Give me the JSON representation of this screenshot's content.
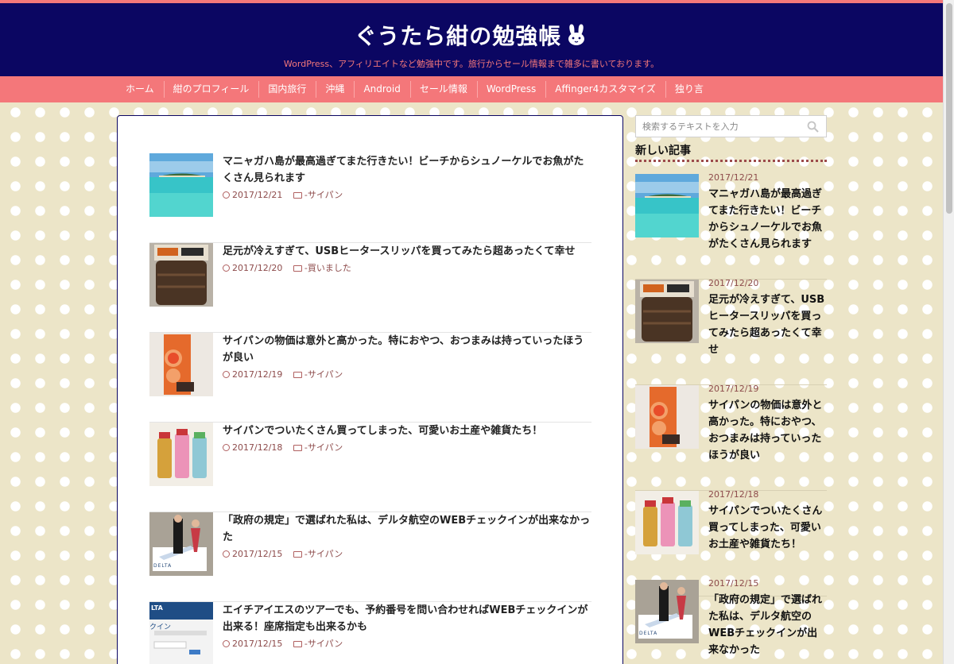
{
  "site": {
    "title": "ぐうたら紺の勉強帳",
    "description": "WordPress、アフィリエイトなど勉強中です。旅行からセール情報まで雑多に書いております。"
  },
  "nav": {
    "items": [
      "ホーム",
      "紺のプロフィール",
      "国内旅行",
      "沖縄",
      "Android",
      "セール情報",
      "WordPress",
      "Affinger4カスタマイズ",
      "独り言"
    ]
  },
  "posts": [
    {
      "title": "マニャガハ島が最高過ぎてまた行きたい！ビーチからシュノーケルでお魚がたくさん見られます",
      "date": "2017/12/21",
      "category": "-サイパン"
    },
    {
      "title": "足元が冷えすぎて、USBヒータースリッパを買ってみたら超あったくて幸せ",
      "date": "2017/12/20",
      "category": "-買いました"
    },
    {
      "title": "サイパンの物価は意外と高かった。特におやつ、おつまみは持っていったほうが良い",
      "date": "2017/12/19",
      "category": "-サイパン"
    },
    {
      "title": "サイパンでついたくさん買ってしまった、可愛いお土産や雑貨たち！",
      "date": "2017/12/18",
      "category": "-サイパン"
    },
    {
      "title": "「政府の規定」で選ばれた私は、デルタ航空のWEBチェックインが出来なかった",
      "date": "2017/12/15",
      "category": "-サイパン"
    },
    {
      "title": "エイチアイエスのツアーでも、予約番号を問い合わせればWEBチェックインが出来る！座席指定も出来るかも",
      "date": "2017/12/15",
      "category": "-サイパン"
    }
  ],
  "sidebar": {
    "search_placeholder": "検索するテキストを入力",
    "heading": "新しい記事",
    "posts": [
      {
        "date": "2017/12/21",
        "title": "マニャガハ島が最高過ぎてまた行きたい！ビーチからシュノーケルでお魚がたくさん見られます"
      },
      {
        "date": "2017/12/20",
        "title": "足元が冷えすぎて、USBヒータースリッパを買ってみたら超あったくて幸せ"
      },
      {
        "date": "2017/12/19",
        "title": "サイパンの物価は意外と高かった。特におやつ、おつまみは持っていったほうが良い"
      },
      {
        "date": "2017/12/18",
        "title": "サイパンでついたくさん買ってしまった、可愛いお土産や雑貨たち！"
      },
      {
        "date": "2017/12/15",
        "title": "「政府の規定」で選ばれた私は、デルタ航空のWEBチェックインが出来なかった"
      }
    ]
  },
  "thumb_text": {
    "delta": "DELTA",
    "hisweb_logo": "LTA",
    "hisweb_text": "クイン"
  },
  "colors": {
    "header_bg": "#0b0662",
    "accent": "#f4777a",
    "page_bg": "#ece5c8",
    "meta_text": "#8d4b4b"
  },
  "icons": {
    "clock": "clock-icon",
    "folder": "folder-icon",
    "search": "search-icon",
    "rabbit": "rabbit-icon"
  }
}
